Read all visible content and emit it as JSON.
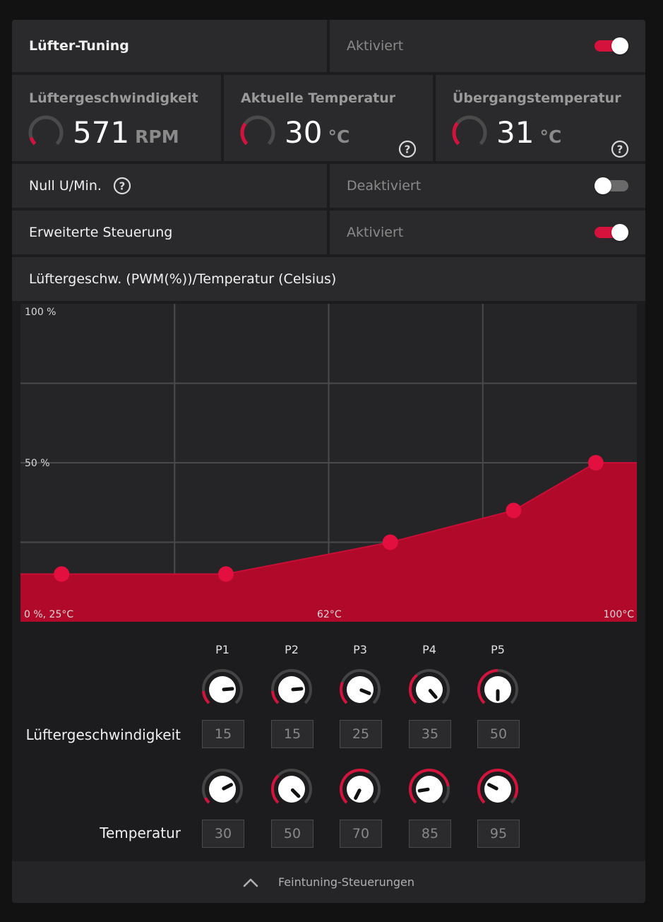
{
  "header": {
    "title": "Lüfter-Tuning",
    "state": "Aktiviert",
    "enabled": true
  },
  "stats": [
    {
      "title": "Lüftergeschwindigkeit",
      "value": "571",
      "unit": "RPM",
      "gauge_fraction": 0.1,
      "help": false
    },
    {
      "title": "Aktuelle Temperatur",
      "value": "30",
      "unit": "°C",
      "gauge_fraction": 0.3,
      "help": true
    },
    {
      "title": "Übergangstemperatur",
      "value": "31",
      "unit": "°C",
      "gauge_fraction": 0.31,
      "help": true
    }
  ],
  "zero_rpm": {
    "label": "Null U/Min.",
    "state": "Deaktiviert",
    "enabled": false,
    "help": true
  },
  "advanced": {
    "label": "Erweiterte Steuerung",
    "state": "Aktiviert",
    "enabled": true
  },
  "chart_header": "Lüftergeschw. (PWM(%))/Temperatur (Celsius)",
  "chart_data": {
    "type": "area",
    "title": "Lüftergeschw. (PWM(%))/Temperatur (Celsius)",
    "x": [
      30,
      50,
      70,
      85,
      95
    ],
    "series": [
      {
        "values": [
          15,
          15,
          25,
          35,
          50
        ]
      }
    ],
    "xlim": [
      25,
      100
    ],
    "ylim": [
      0,
      100
    ],
    "labels": {
      "top": "100 %",
      "mid": "50 %",
      "origin": "0 %, 25°C",
      "xmid": "62°C",
      "xmax": "100°C"
    },
    "grid": true,
    "fill_color": "#b0092a",
    "point_color": "#e3103f"
  },
  "points": [
    "P1",
    "P2",
    "P3",
    "P4",
    "P5"
  ],
  "speed_row": {
    "label": "Lüftergeschwindigkeit",
    "values": [
      "15",
      "15",
      "25",
      "35",
      "50"
    ]
  },
  "temp_row": {
    "label": "Temperatur",
    "values": [
      "30",
      "50",
      "70",
      "85",
      "95"
    ]
  },
  "footer": {
    "label": "Feintuning-Steuerungen",
    "icon": "chevron-up-icon"
  },
  "colors": {
    "accent": "#d5123c"
  }
}
